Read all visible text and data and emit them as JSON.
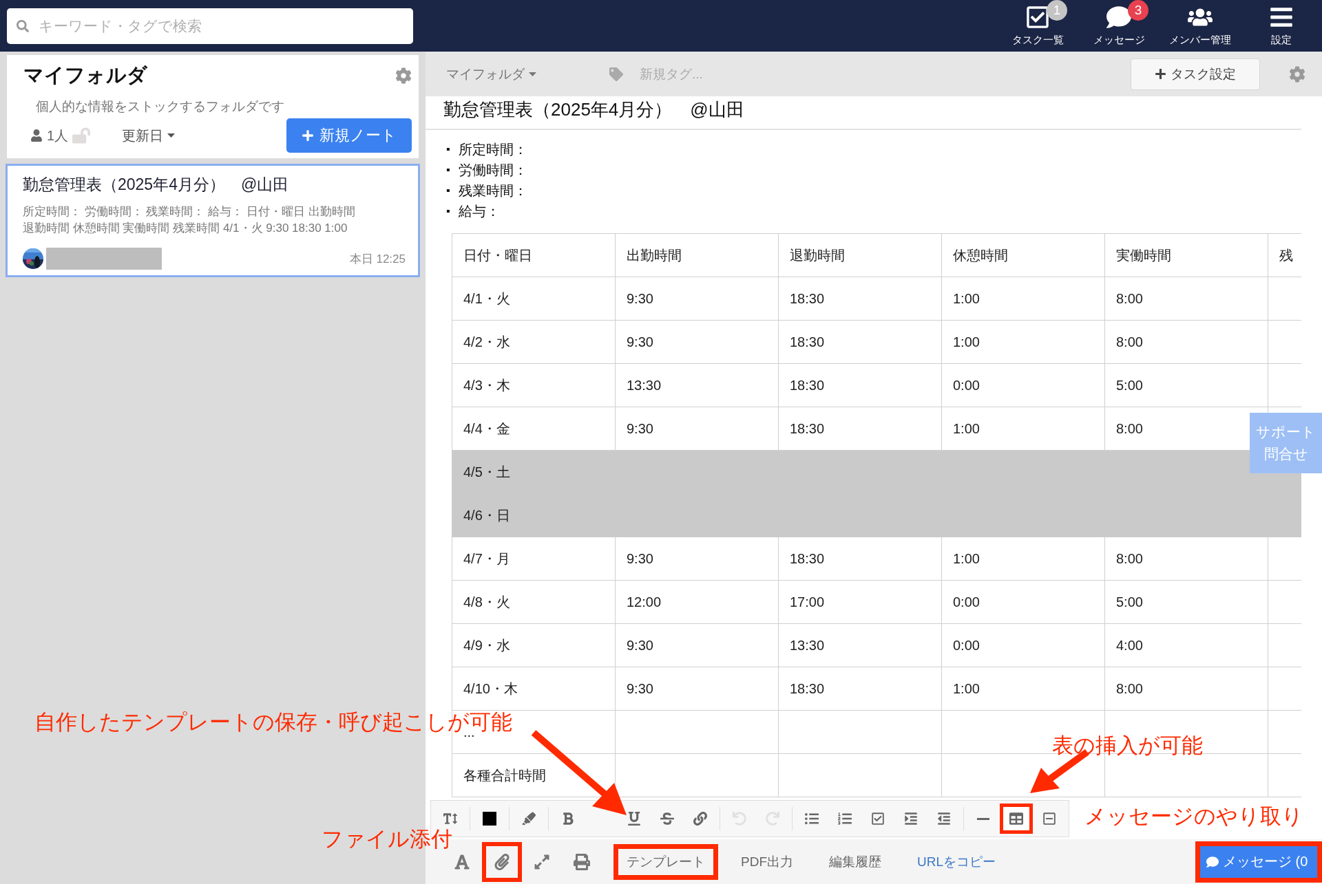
{
  "search": {
    "placeholder": "キーワード・タグで検索"
  },
  "nav": [
    {
      "kind": "tasks",
      "label": "タスク一覧",
      "badge": "1",
      "color": "#c4c4c4"
    },
    {
      "kind": "messages",
      "label": "メッセージ",
      "badge": "3",
      "color": "#e8414f"
    },
    {
      "kind": "members",
      "label": "メンバー管理"
    },
    {
      "kind": "settings",
      "label": "設定"
    }
  ],
  "folder": {
    "title": "マイフォルダ",
    "description": "個人的な情報をストックするフォルダです",
    "members": "1人",
    "sort": "更新日",
    "new_button": "新規ノート"
  },
  "notes": [
    {
      "title": "勤怠管理表（2025年4月分）　@山田",
      "excerpt_lines": [
        "所定時間：  労働時間：  残業時間：  給与：  日付・曜日 出勤時間",
        "退勤時間 休憩時間 実働時間 残業時間 4/1・火 9:30 18:30 1:00"
      ],
      "time": "本日 12:25",
      "selected": true
    }
  ],
  "header": {
    "folder": "マイフォルダ",
    "tag_placeholder": "新規タグ...",
    "task_button": "タスク設定"
  },
  "document": {
    "title": "勤怠管理表（2025年4月分）　@山田",
    "bullet_marker": "▪",
    "bullets": [
      "所定時間：",
      "労働時間：",
      "残業時間：",
      "給与："
    ],
    "table": {
      "columns": [
        "日付・曜日",
        "出勤時間",
        "退勤時間",
        "休憩時間",
        "実働時間",
        "残"
      ],
      "rows": [
        {
          "cells": [
            "4/1・火",
            "9:30",
            "18:30",
            "1:00",
            "8:00"
          ],
          "shaded": false
        },
        {
          "cells": [
            "4/2・水",
            "9:30",
            "18:30",
            "1:00",
            "8:00"
          ],
          "shaded": false
        },
        {
          "cells": [
            "4/3・木",
            "13:30",
            "18:30",
            "0:00",
            "5:00"
          ],
          "shaded": false
        },
        {
          "cells": [
            "4/4・金",
            "9:30",
            "18:30",
            "1:00",
            "8:00"
          ],
          "shaded": false
        },
        {
          "cells": [
            "4/5・土"
          ],
          "shaded": true
        },
        {
          "cells": [
            "4/6・日"
          ],
          "shaded": true
        },
        {
          "cells": [
            "4/7・月",
            "9:30",
            "18:30",
            "1:00",
            "8:00"
          ],
          "shaded": false
        },
        {
          "cells": [
            "4/8・火",
            "12:00",
            "17:00",
            "0:00",
            "5:00"
          ],
          "shaded": false
        },
        {
          "cells": [
            "4/9・水",
            "9:30",
            "13:30",
            "0:00",
            "4:00"
          ],
          "shaded": false
        },
        {
          "cells": [
            "4/10・木",
            "9:30",
            "18:30",
            "1:00",
            "8:00"
          ],
          "shaded": false
        },
        {
          "cells": [
            "..."
          ],
          "shaded": false
        },
        {
          "cells": [
            "各種合計時間"
          ],
          "shaded": false
        }
      ]
    }
  },
  "editor_toolbar": [
    {
      "kind": "text-size",
      "disabled": false,
      "highlighted": false
    },
    {
      "kind": "color",
      "color": "#000000",
      "disabled": false,
      "highlighted": false
    },
    {
      "kind": "highlighter",
      "disabled": false,
      "highlighted": false
    },
    {
      "kind": "bold",
      "disabled": false,
      "highlighted": false
    },
    {
      "kind": "underline",
      "disabled": false,
      "highlighted": false
    },
    {
      "kind": "strike",
      "disabled": false,
      "highlighted": false
    },
    {
      "kind": "link",
      "disabled": false,
      "highlighted": false
    },
    {
      "kind": "undo",
      "disabled": true,
      "highlighted": false
    },
    {
      "kind": "redo",
      "disabled": true,
      "highlighted": false
    },
    {
      "kind": "bullet-list",
      "disabled": false,
      "highlighted": false
    },
    {
      "kind": "number-list",
      "disabled": false,
      "highlighted": false
    },
    {
      "kind": "checklist",
      "disabled": false,
      "highlighted": false
    },
    {
      "kind": "indent",
      "disabled": false,
      "highlighted": false
    },
    {
      "kind": "outdent",
      "disabled": false,
      "highlighted": false
    },
    {
      "kind": "rule",
      "disabled": false,
      "highlighted": false
    },
    {
      "kind": "table",
      "disabled": false,
      "highlighted": true
    },
    {
      "kind": "collapse",
      "disabled": false,
      "highlighted": false
    }
  ],
  "bottom_bar": {
    "tools": [
      {
        "kind": "font",
        "highlighted": false
      },
      {
        "kind": "attach",
        "highlighted": true
      },
      {
        "kind": "expand",
        "highlighted": false
      },
      {
        "kind": "print",
        "highlighted": false
      }
    ],
    "actions": [
      {
        "label": "テンプレート",
        "kind": "plain",
        "highlighted": true
      },
      {
        "label": "PDF出力",
        "kind": "plain",
        "highlighted": false
      },
      {
        "label": "編集履歴",
        "kind": "plain",
        "highlighted": false
      },
      {
        "label": "URLをコピー",
        "kind": "link",
        "highlighted": false
      }
    ],
    "message_button": {
      "label": "メッセージ (0",
      "highlighted": true
    }
  },
  "support": {
    "label": "サポート問合せ"
  },
  "annotations": [
    {
      "text": "自作したテンプレートの保存・呼び起こしが可能"
    },
    {
      "text": "表の挿入が可能"
    },
    {
      "text": "メッセージのやり取り"
    },
    {
      "text": "ファイル添付"
    }
  ]
}
